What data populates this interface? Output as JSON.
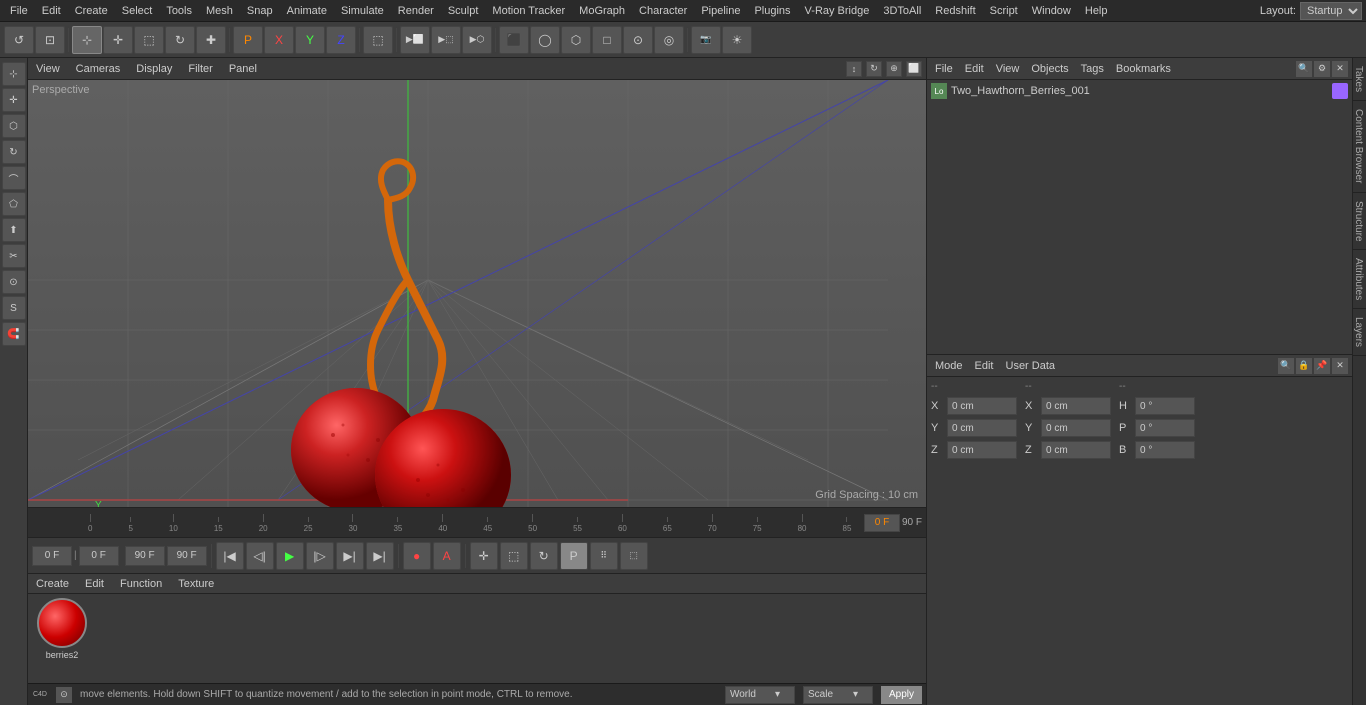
{
  "menubar": {
    "items": [
      "File",
      "Edit",
      "Create",
      "Select",
      "Tools",
      "Mesh",
      "Snap",
      "Animate",
      "Simulate",
      "Render",
      "Sculpt",
      "Motion Tracker",
      "MoGraph",
      "Character",
      "Pipeline",
      "Plugins",
      "V-Ray Bridge",
      "3DToAll",
      "Redshift",
      "Script",
      "Window",
      "Help"
    ],
    "layout_label": "Layout:",
    "layout_value": "Startup"
  },
  "toolbar": {
    "undo_label": "↺",
    "tools": [
      "↺",
      "⬚",
      "✜",
      "⬚",
      "↻",
      "✚",
      "P",
      "X",
      "Y",
      "Z",
      "⬚",
      "⬜",
      "▶",
      "⬚",
      "⬚",
      "⬚",
      "⬚",
      "⬡",
      "○",
      "⬡",
      "□",
      "△",
      "◇",
      "⬚",
      "⬛",
      "☀"
    ]
  },
  "viewport": {
    "menus": [
      "View",
      "Cameras",
      "Display",
      "Filter",
      "Panel"
    ],
    "label": "Perspective",
    "grid_spacing": "Grid Spacing : 10 cm"
  },
  "timeline": {
    "ticks": [
      0,
      5,
      10,
      15,
      20,
      25,
      30,
      35,
      40,
      45,
      50,
      55,
      60,
      65,
      70,
      75,
      80,
      85,
      90
    ],
    "current_frame": "0 F",
    "end_frame": "90 F"
  },
  "playback": {
    "start_frame": "0 F",
    "min_frame": "0 F",
    "max_frame": "90 F",
    "end_frame": "90 F",
    "current_frame_display": "0 F"
  },
  "objects_panel": {
    "title": "Objects",
    "menus": [
      "File",
      "Edit",
      "View",
      "Objects",
      "Tags",
      "Bookmarks"
    ],
    "items": [
      {
        "name": "Two_Hawthorn_Berries_001",
        "icon": "Lo",
        "has_dot": true
      }
    ]
  },
  "attributes_panel": {
    "menus": [
      "Mode",
      "Edit",
      "User Data"
    ],
    "coords": {
      "x_pos": "0 cm",
      "y_pos": "0 cm",
      "z_pos": "0 cm",
      "h_rot": "0 °",
      "p_rot": "0 °",
      "b_rot": "0 °"
    }
  },
  "bottom_panel": {
    "menus": [
      "Create",
      "Edit",
      "Function",
      "Texture"
    ],
    "material_name": "berries2"
  },
  "statusbar": {
    "text": "move elements. Hold down SHIFT to quantize movement / add to the selection in point mode, CTRL to remove.",
    "coord_system": "World",
    "transform_mode": "Scale",
    "apply_label": "Apply"
  },
  "right_tabs": {
    "tabs": [
      "Takes",
      "Content Browser",
      "Structure",
      "Attributes",
      "Layers"
    ]
  },
  "icons": {
    "undo": "↺",
    "redo": "↻",
    "play": "▶",
    "stop": "■",
    "step_forward": "▶|",
    "step_back": "|◀",
    "goto_start": "|◀◀",
    "goto_end": "▶▶|",
    "loop": "↻",
    "record": "●",
    "auto_key": "A",
    "search": "🔍",
    "lock": "🔒"
  }
}
